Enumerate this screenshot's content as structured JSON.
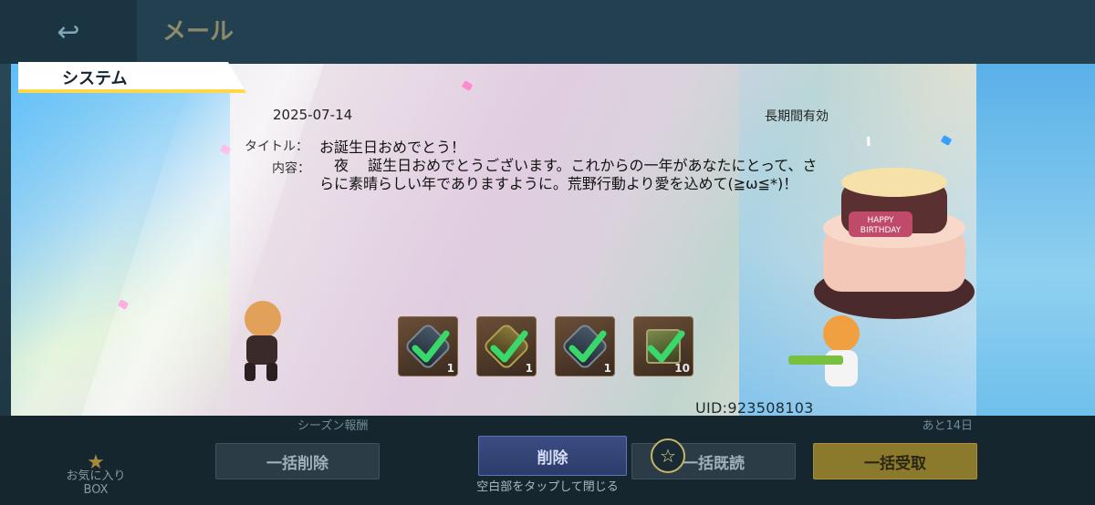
{
  "background": {
    "header_title": "メール",
    "back_icon": "back-arrow-icon",
    "list_row_name": "シーズン報酬",
    "list_row_time": "あと14日",
    "favorites_label_line1": "お気に入り",
    "favorites_label_line2": "BOX",
    "buttons": {
      "bulk_delete": "一括削除",
      "delete": "削除",
      "bulk_read": "一括既読",
      "bulk_receive": "一括受取"
    },
    "tap_hint": "空白部をタップして閉じる"
  },
  "mail": {
    "tab_label": "システム",
    "date": "2025-07-14",
    "expiry": "長期間有効",
    "title_label": "タイトル：",
    "title": "お誕生日おめでとう！",
    "content_label": "内容：",
    "content": "　夜　 誕生日おめでとうございます。これからの一年があなたにとって、さらに素晴らしい年でありますように。荒野行動より愛を込めて(≧ω≦*)！",
    "rewards": [
      {
        "icon": "silver-crate-icon",
        "quantity": "1",
        "received": true
      },
      {
        "icon": "gold-crate-icon",
        "quantity": "1",
        "received": true
      },
      {
        "icon": "dark-crate-icon",
        "quantity": "1",
        "received": true
      },
      {
        "icon": "ticket-tile-icon",
        "quantity": "10",
        "received": true
      }
    ],
    "uid": "UID:923508103"
  },
  "colors": {
    "accent_yellow": "#ffd84a",
    "check_green": "#3ad86a",
    "receive_button": "#8c7a2c",
    "delete_button": "#3b4c82"
  }
}
